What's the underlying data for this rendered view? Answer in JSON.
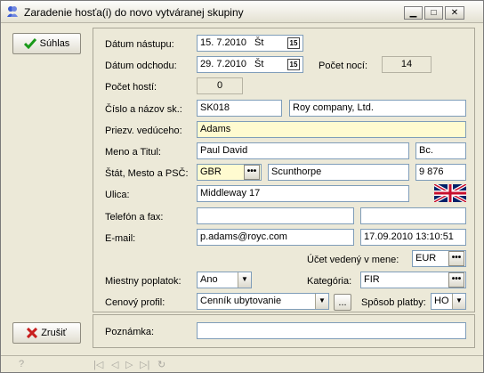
{
  "window": {
    "title": "Zaradenie hosťa(i) do novo vytváranej skupiny"
  },
  "buttons": {
    "ok": "Súhlas",
    "cancel": "Zrušiť",
    "dots": "•••",
    "dots_small": "..."
  },
  "form": {
    "arrival_label": "Dátum nástupu:",
    "arrival_date": "15. 7.2010",
    "arrival_day": "Št",
    "departure_label": "Dátum odchodu:",
    "departure_date": "29. 7.2010",
    "departure_day": "Št",
    "nights_label": "Počet nocí:",
    "nights": "14",
    "guests_label": "Počet hostí:",
    "guests": "0",
    "number_name_label": "Číslo a názov sk.:",
    "group_number": "SK018",
    "group_name": "Roy company, Ltd.",
    "leader_label": "Priezv. vedúceho:",
    "leader": "Adams",
    "name_title_label": "Meno a Titul:",
    "first_name": "Paul David",
    "title": "Bc.",
    "state_city_zip_label": "Štát, Mesto a PSČ:",
    "country_code": "GBR",
    "city": "Scunthorpe",
    "zip": "9 876",
    "street_label": "Ulica:",
    "street": "Middleway 17",
    "phone_fax_label": "Telefón a fax:",
    "phone": "",
    "fax": "",
    "email_label": "E-mail:",
    "email": "p.adams@royc.com",
    "email_timestamp": "17.09.2010 13:10:51",
    "currency_label": "Účet vedený v mene:",
    "currency": "EUR",
    "local_fee_label": "Miestny poplatok:",
    "local_fee": "Ano",
    "category_label": "Kategória:",
    "category": "FIR",
    "price_profile_label": "Cenový profil:",
    "price_profile": "Cenník ubytovanie",
    "payment_label": "Spôsob platby:",
    "payment": "HO",
    "note_label": "Poznámka:",
    "note": ""
  },
  "status": {
    "help": "?",
    "nav": [
      "|◁",
      "◁",
      "▷",
      "▷|",
      "↻"
    ]
  },
  "icons": {
    "ok": "checkmark-icon",
    "cancel": "x-icon",
    "flag": "uk-flag-icon",
    "calendar": "calendar-icon",
    "app": "app-icon"
  },
  "colors": {
    "highlight_field": "#fffbd0",
    "window_bg": "#ece9d8"
  }
}
